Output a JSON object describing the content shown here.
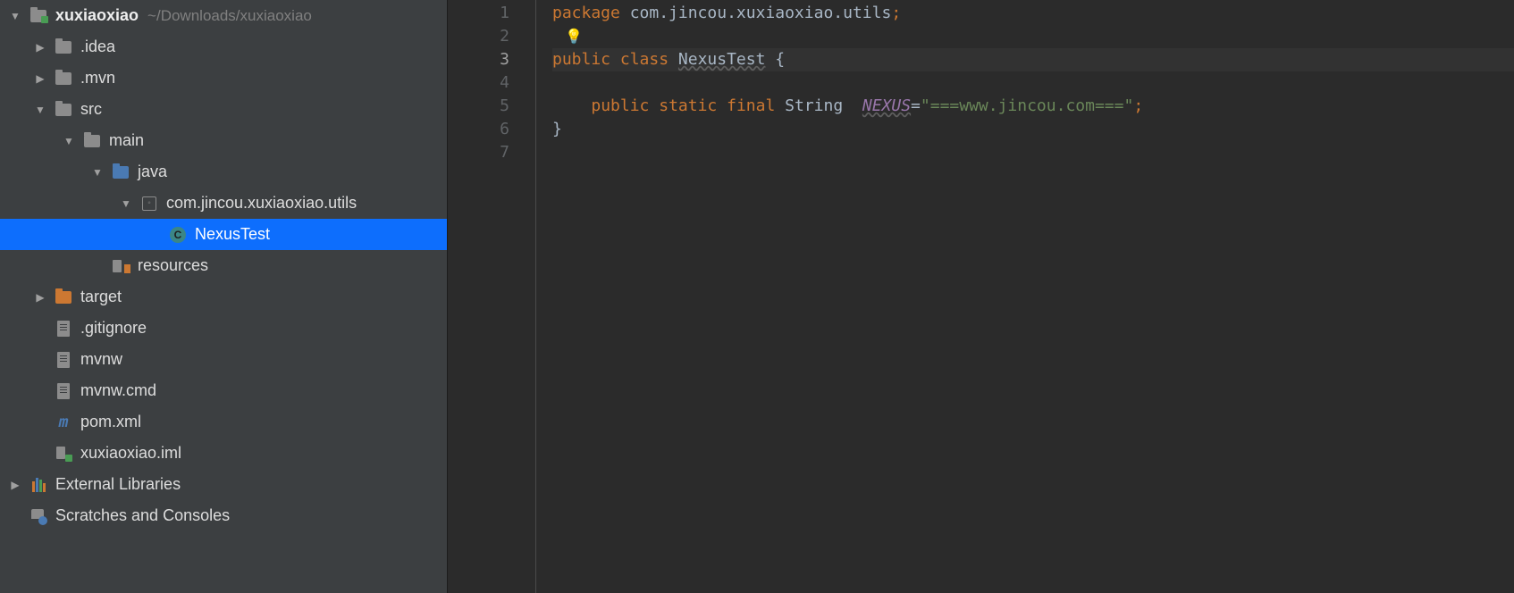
{
  "project": {
    "root_name": "xuxiaoxiao",
    "root_path": "~/Downloads/xuxiaoxiao",
    "tree": {
      "idea": ".idea",
      "mvn": ".mvn",
      "src": "src",
      "main": "main",
      "java": "java",
      "package": "com.jincou.xuxiaoxiao.utils",
      "nexus_test": "NexusTest",
      "resources": "resources",
      "target": "target",
      "gitignore": ".gitignore",
      "mvnw": "mvnw",
      "mvnw_cmd": "mvnw.cmd",
      "pom": "pom.xml",
      "iml": "xuxiaoxiao.iml",
      "external_libs": "External Libraries",
      "scratches": "Scratches and Consoles"
    }
  },
  "gutter": {
    "lines": [
      "1",
      "2",
      "3",
      "4",
      "5",
      "6",
      "7"
    ],
    "current_line": 3
  },
  "code": {
    "l1": {
      "kw": "package",
      "pkg_main": "com.jincou.xuxiaoxiao.utils",
      "semi": ";"
    },
    "l3": {
      "kw1": "public",
      "kw2": "class",
      "cls": "NexusTest",
      "brace": "{"
    },
    "l5": {
      "kw1": "public",
      "kw2": "static",
      "kw3": "final",
      "type": "String",
      "fld": "NEXUS",
      "eq": "=",
      "str": "\"===www.jincou.com===\"",
      "semi": ";"
    },
    "l6": {
      "brace": "}"
    }
  },
  "icons": {
    "bulb": "💡"
  }
}
